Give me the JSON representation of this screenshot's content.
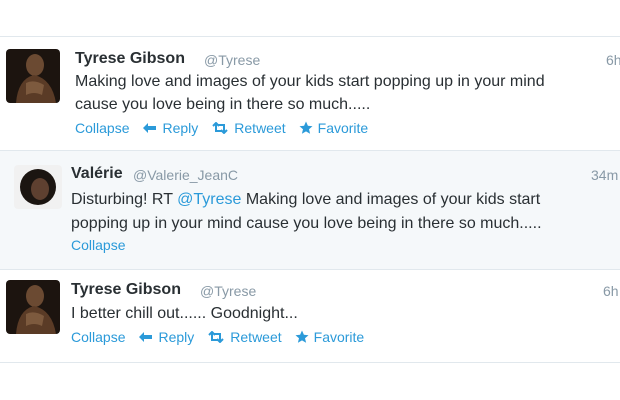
{
  "tweets": [
    {
      "name": "Tyrese Gibson",
      "handle": "@Tyrese",
      "time": "6h",
      "text_line1": "Making love and images of your kids start popping up in your mind",
      "text_line2": "cause you love being in there so much.....",
      "actions": {
        "collapse": "Collapse",
        "reply": "Reply",
        "retweet": "Retweet",
        "favorite": "Favorite"
      }
    },
    {
      "name": "Valérie",
      "handle": "@Valerie_JeanC",
      "time": "34m",
      "text_prefix": "Disturbing! RT ",
      "text_mention": "@Tyrese",
      "text_rest": " Making love and images of your kids start",
      "text_line2": "popping up in your mind cause you love being in there so much.....",
      "actions": {
        "collapse": "Collapse"
      }
    },
    {
      "name": "Tyrese Gibson",
      "handle": "@Tyrese",
      "time": "6h",
      "text_line1": "I better chill out...... Goodnight...",
      "actions": {
        "collapse": "Collapse",
        "reply": "Reply",
        "retweet": "Retweet",
        "favorite": "Favorite"
      }
    }
  ],
  "colors": {
    "link": "#2b9ad9",
    "name": "#292f33",
    "meta": "#8899a6",
    "highlight_bg": "#f5f8fa",
    "divider": "#e1e8ed"
  },
  "icons": [
    "reply-arrow-icon",
    "retweet-icon",
    "favorite-star-icon"
  ]
}
